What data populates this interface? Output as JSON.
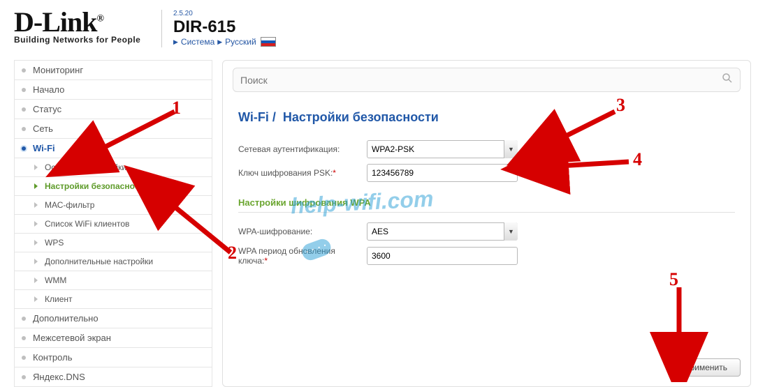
{
  "brand": {
    "name": "D-Link",
    "reg": "®",
    "tagline": "Building Networks for People"
  },
  "version": "2.5.20",
  "model": "DIR-615",
  "breadcrumb": {
    "system": "Система",
    "lang": "Русский"
  },
  "search": {
    "placeholder": "Поиск"
  },
  "page_title_prefix": "Wi-Fi /",
  "page_title": "Настройки безопасности",
  "sidebar": {
    "items": [
      {
        "label": "Мониторинг"
      },
      {
        "label": "Начало"
      },
      {
        "label": "Статус"
      },
      {
        "label": "Сеть"
      },
      {
        "label": "Wi-Fi",
        "selected": true,
        "children": [
          {
            "label": "Основные настройки"
          },
          {
            "label": "Настройки безопасности",
            "selected": true
          },
          {
            "label": "МАС-фильтр"
          },
          {
            "label": "Список WiFi клиентов"
          },
          {
            "label": "WPS"
          },
          {
            "label": "Дополнительные настройки"
          },
          {
            "label": "WMM"
          },
          {
            "label": "Клиент"
          }
        ]
      },
      {
        "label": "Дополнительно"
      },
      {
        "label": "Межсетевой экран"
      },
      {
        "label": "Контроль"
      },
      {
        "label": "Яндекс.DNS"
      }
    ]
  },
  "form": {
    "auth_label": "Сетевая аутентификация:",
    "auth_value": "WPA2-PSK",
    "psk_label": "Ключ шифрования PSK:",
    "psk_value": "123456789",
    "wpa_section": "Настройки шифрования WPA",
    "cipher_label": "WPA-шифрование:",
    "cipher_value": "AES",
    "rekey_label": "WPA период обновления ключа:",
    "rekey_value": "3600"
  },
  "apply_label": "Применить",
  "watermark": "help-wifi.com",
  "annotations": {
    "n1": "1",
    "n2": "2",
    "n3": "3",
    "n4": "4",
    "n5": "5"
  }
}
